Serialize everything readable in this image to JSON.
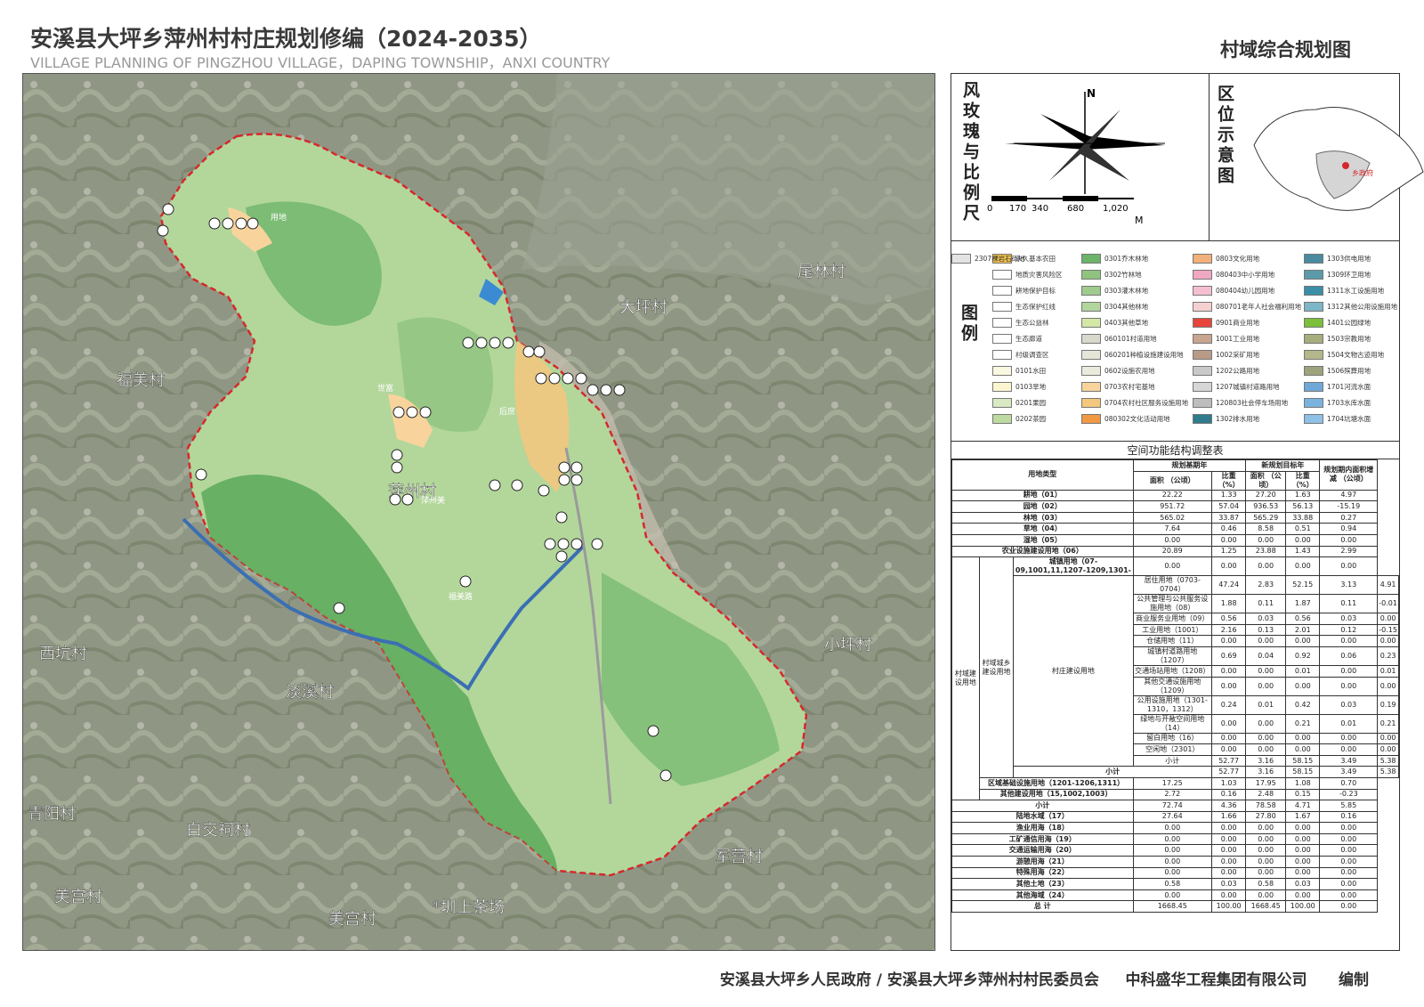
{
  "title": "安溪县大坪乡萍州村村庄规划修编（2024-2035）",
  "subtitle": "VILLAGE PLANNING OF PINGZHOU VILLAGE，DAPING TOWNSHIP，ANXI COUNTRY",
  "sheet_title": "村域综合规划图",
  "map_labels": {
    "weilin": "尾林村",
    "daping": "大坪村",
    "fumei": "福美村",
    "pingzhou": "萍州村",
    "xikeng": "西坑村",
    "xiaoping": "小坪村",
    "danxi": "淡溪村",
    "qingyang": "青阳村",
    "baijiaoci": "白交祠村",
    "junying": "军营村",
    "meigong1": "美宫村",
    "meigong2": "美宫村",
    "tea": "*圳上茶场",
    "shifu": "世富",
    "houlu": "后庶",
    "tunzhou": "萍州美",
    "fumeilu": "福美路",
    "yongdi": "用地"
  },
  "rose": {
    "label": "风玫瑰与比例尺",
    "north": "N",
    "scale": [
      "0",
      "170",
      "340",
      "680",
      "1,020"
    ],
    "unit": "M"
  },
  "location": {
    "label": "区位示意图",
    "marker": "乡政府"
  },
  "legend": {
    "label": "图例",
    "items": [
      {
        "t": "永久基本农田",
        "c": "#f3c24a"
      },
      {
        "t": "地质灾害风险区",
        "c": "#ffffff"
      },
      {
        "t": "耕地保护目标",
        "c": "#ffffff"
      },
      {
        "t": "生态保护红线",
        "c": "#ffffff"
      },
      {
        "t": "生态公益林",
        "c": "#ffffff"
      },
      {
        "t": "生态廊道",
        "c": "#ffffff"
      },
      {
        "t": "村级调查区",
        "c": "#ffffff"
      },
      {
        "t": "0101水田",
        "c": "#fbf8e2"
      },
      {
        "t": "0103旱地",
        "c": "#fbf6d0"
      },
      {
        "t": "0201果园",
        "c": "#d9e9c2"
      },
      {
        "t": "0202茶园",
        "c": "#bddba0"
      },
      {
        "t": "0301乔木林地",
        "c": "#6bb46a"
      },
      {
        "t": "0302竹林地",
        "c": "#8fc37f"
      },
      {
        "t": "0303灌木林地",
        "c": "#9fcb8d"
      },
      {
        "t": "0304其他林地",
        "c": "#b1d59c"
      },
      {
        "t": "0403其他草地",
        "c": "#d3e7a6"
      },
      {
        "t": "060101村道用地",
        "c": "#d8d8cc"
      },
      {
        "t": "060201种植设施建设用地",
        "c": "#e6e6d8"
      },
      {
        "t": "0602设施农用地",
        "c": "#ebebdd"
      },
      {
        "t": "0703农村宅基地",
        "c": "#f8d49c"
      },
      {
        "t": "0704农村社区服务设施用地",
        "c": "#f4c77e"
      },
      {
        "t": "080302文化活动用地",
        "c": "#f29944"
      },
      {
        "t": "0803文化用地",
        "c": "#f2b07a"
      },
      {
        "t": "080403中小学用地",
        "c": "#f0a7c1"
      },
      {
        "t": "080404幼儿园用地",
        "c": "#f5bfd2"
      },
      {
        "t": "080701老年人社会福利用地",
        "c": "#f5d0d0"
      },
      {
        "t": "0901商业用地",
        "c": "#e7443b"
      },
      {
        "t": "1001工业用地",
        "c": "#c7a58f"
      },
      {
        "t": "1002采矿用地",
        "c": "#b89a86"
      },
      {
        "t": "1202公路用地",
        "c": "#c9c9c9"
      },
      {
        "t": "1207城镇村道路用地",
        "c": "#d6d6d6"
      },
      {
        "t": "120803社会停车场用地",
        "c": "#bdbdbd"
      },
      {
        "t": "1302排水用地",
        "c": "#2f7c8c"
      },
      {
        "t": "1303供电用地",
        "c": "#4a8ba0"
      },
      {
        "t": "1309环卫用地",
        "c": "#5b9aa8"
      },
      {
        "t": "1311水工设施用地",
        "c": "#3a8fa6"
      },
      {
        "t": "1312其他公用设施用地",
        "c": "#7db6c6"
      },
      {
        "t": "1401公园绿地",
        "c": "#7bbf3a"
      },
      {
        "t": "1503宗教用地",
        "c": "#a8ad7c"
      },
      {
        "t": "1504文物古迹用地",
        "c": "#b3b78a"
      },
      {
        "t": "1506殡葬用地",
        "c": "#9da37b"
      },
      {
        "t": "1701河流水面",
        "c": "#6fa8d8"
      },
      {
        "t": "1703水库水面",
        "c": "#7ab4de"
      },
      {
        "t": "1704坑塘水面",
        "c": "#8fc0e6"
      },
      {
        "t": "2307裸岩石砾地",
        "c": "#e3e3e3"
      }
    ]
  },
  "table": {
    "title": "空间功能结构调整表",
    "headers": {
      "type": "用地类型",
      "base": "规划基期年",
      "target": "新规划目标年",
      "area": "面积 （公顷）",
      "ratio": "比重 （%）",
      "change": "规划期内面积增减 （公顷）"
    },
    "rows": [
      [
        "耕地（01）",
        "22.22",
        "1.33",
        "27.20",
        "1.63",
        "4.97"
      ],
      [
        "园地（02）",
        "951.72",
        "57.04",
        "936.53",
        "56.13",
        "-15.19"
      ],
      [
        "林地（03）",
        "565.02",
        "33.87",
        "565.29",
        "33.88",
        "0.27"
      ],
      [
        "草地（04）",
        "7.64",
        "0.46",
        "8.58",
        "0.51",
        "0.94"
      ],
      [
        "湿地（05）",
        "0.00",
        "0.00",
        "0.00",
        "0.00",
        "0.00"
      ],
      [
        "农业设施建设用地（06）",
        "20.89",
        "1.25",
        "23.88",
        "1.43",
        "2.99"
      ],
      [
        "城镇用地（07-09,1001,11,1207-1209,1301-",
        "0.00",
        "0.00",
        "0.00",
        "0.00",
        "0.00"
      ],
      [
        "居住用地（0703-0704）",
        "47.24",
        "2.83",
        "52.15",
        "3.13",
        "4.91"
      ],
      [
        "公共管理与公共服务设施用地（08）",
        "1.88",
        "0.11",
        "1.87",
        "0.11",
        "-0.01"
      ],
      [
        "商业服务业用地（09）",
        "0.56",
        "0.03",
        "0.56",
        "0.03",
        "0.00"
      ],
      [
        "工业用地（1001）",
        "2.16",
        "0.13",
        "2.01",
        "0.12",
        "-0.15"
      ],
      [
        "仓储用地（11）",
        "0.00",
        "0.00",
        "0.00",
        "0.00",
        "0.00"
      ],
      [
        "城镇村道路用地（1207）",
        "0.69",
        "0.04",
        "0.92",
        "0.06",
        "0.23"
      ],
      [
        "交通场站用地（1208）",
        "0.00",
        "0.00",
        "0.01",
        "0.00",
        "0.01"
      ],
      [
        "其他交通设施用地（1209）",
        "0.00",
        "0.00",
        "0.00",
        "0.00",
        "0.00"
      ],
      [
        "公用设施用地（1301-1310，1312）",
        "0.24",
        "0.01",
        "0.42",
        "0.03",
        "0.19"
      ],
      [
        "绿地与开敞空间用地（14）",
        "0.00",
        "0.00",
        "0.21",
        "0.01",
        "0.21"
      ],
      [
        "留白用地（16）",
        "0.00",
        "0.00",
        "0.00",
        "0.00",
        "0.00"
      ],
      [
        "空闲地（2301）",
        "0.00",
        "0.00",
        "0.00",
        "0.00",
        "0.00"
      ],
      [
        "小计",
        "52.77",
        "3.16",
        "58.15",
        "3.49",
        "5.38"
      ],
      [
        "小计",
        "52.77",
        "3.16",
        "58.15",
        "3.49",
        "5.38"
      ],
      [
        "区域基础设施用地（1201-1206,1311）",
        "17.25",
        "1.03",
        "17.95",
        "1.08",
        "0.70"
      ],
      [
        "其他建设用地（15,1002,1003）",
        "2.72",
        "0.16",
        "2.48",
        "0.15",
        "-0.23"
      ],
      [
        "小计",
        "72.74",
        "4.36",
        "78.58",
        "4.71",
        "5.85"
      ],
      [
        "陆地水域（17）",
        "27.64",
        "1.66",
        "27.80",
        "1.67",
        "0.16"
      ],
      [
        "渔业用海（18）",
        "0.00",
        "0.00",
        "0.00",
        "0.00",
        "0.00"
      ],
      [
        "工矿通信用海（19）",
        "0.00",
        "0.00",
        "0.00",
        "0.00",
        "0.00"
      ],
      [
        "交通运输用海（20）",
        "0.00",
        "0.00",
        "0.00",
        "0.00",
        "0.00"
      ],
      [
        "游憩用海（21）",
        "0.00",
        "0.00",
        "0.00",
        "0.00",
        "0.00"
      ],
      [
        "特殊用海（22）",
        "0.00",
        "0.00",
        "0.00",
        "0.00",
        "0.00"
      ],
      [
        "其他土地（23）",
        "0.58",
        "0.03",
        "0.58",
        "0.03",
        "0.00"
      ],
      [
        "其他海域（24）",
        "0.00",
        "0.00",
        "0.00",
        "0.00",
        "0.00"
      ],
      [
        "总 计",
        "1668.45",
        "100.00",
        "1668.45",
        "100.00",
        "0.00"
      ]
    ],
    "group_labels": {
      "build": "村域建设用地",
      "rural_build": "村域城乡建设用地",
      "village_build": "村庄建设用地"
    }
  },
  "footer": "安溪县大坪乡人民政府 / 安溪县大坪乡萍州村村民委员会     中科盛华工程集团有限公司      编制"
}
